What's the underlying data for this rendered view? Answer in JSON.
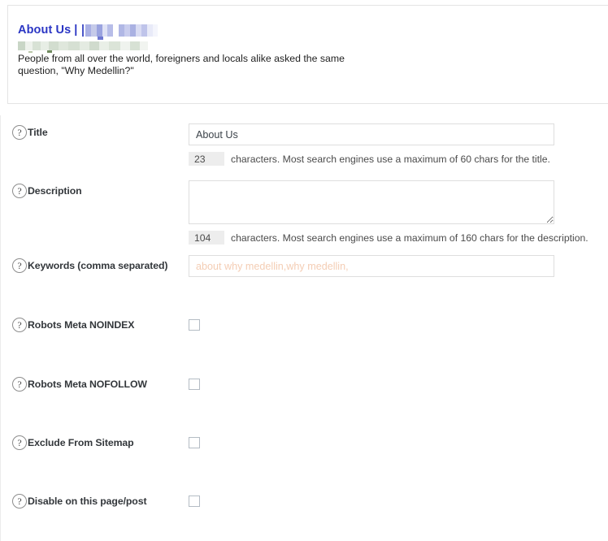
{
  "preview": {
    "title": "About Us",
    "separator": "|",
    "site_name_redacted": "[redacted]",
    "url_redacted": "[redacted]",
    "description": "People from all over the world, foreigners and locals alike asked the same question, \"Why Medellin?\""
  },
  "colors": {
    "snippet_title": "#2b36c4",
    "placeholder": "#f4cdb4",
    "counter_bg": "#ededed",
    "input_border": "#dedede",
    "checkbox_border": "#b4bcc4"
  },
  "fields": {
    "title": {
      "label": "Title",
      "help_icon": "question-mark-icon",
      "value": "About Us",
      "placeholder": "",
      "counter": "23",
      "counter_text": "characters. Most search engines use a maximum of 60 chars for the title."
    },
    "description": {
      "label": "Description",
      "help_icon": "question-mark-icon",
      "value": "",
      "placeholder": "",
      "counter": "104",
      "counter_text": "characters. Most search engines use a maximum of 160 chars for the description."
    },
    "keywords": {
      "label": "Keywords (comma separated)",
      "help_icon": "question-mark-icon",
      "value": "",
      "placeholder": "about why medellin,why medellin,"
    }
  },
  "checkboxes": [
    {
      "label": "Robots Meta NOINDEX",
      "help_icon": "question-mark-icon",
      "checked": false
    },
    {
      "label": "Robots Meta NOFOLLOW",
      "help_icon": "question-mark-icon",
      "checked": false
    },
    {
      "label": "Exclude From Sitemap",
      "help_icon": "question-mark-icon",
      "checked": false
    },
    {
      "label": "Disable on this page/post",
      "help_icon": "question-mark-icon",
      "checked": false
    }
  ],
  "help_glyph": "?"
}
